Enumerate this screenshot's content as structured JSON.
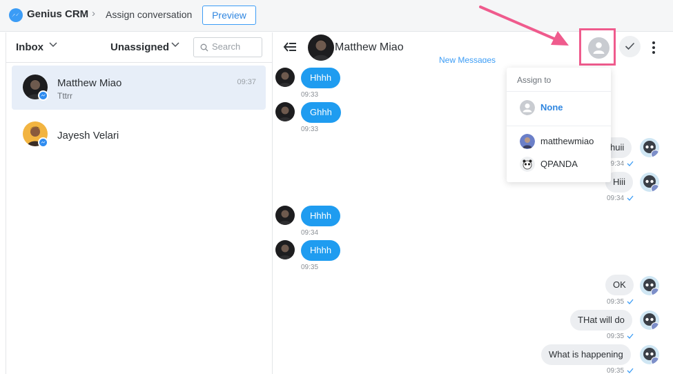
{
  "app": {
    "name": "Genius CRM",
    "breadcrumb_separator": "›",
    "page_title": "Assign conversation",
    "preview_label": "Preview",
    "brand_color": "#3b9cf6"
  },
  "left": {
    "inbox_label": "Inbox",
    "filter_label": "Unassigned",
    "search_placeholder": "Search",
    "conversations": [
      {
        "name": "Matthew Miao",
        "time": "09:37",
        "preview": "Tttrr",
        "active": true
      },
      {
        "name": "Jayesh Velari",
        "time": "",
        "preview": "",
        "active": false
      }
    ]
  },
  "chat": {
    "contact_name": "Matthew Miao",
    "new_messages_label": "New Messages",
    "messages": [
      {
        "direction": "in",
        "text": "Hhhh",
        "time": "09:33"
      },
      {
        "direction": "in",
        "text": "Ghhh",
        "time": "09:33"
      },
      {
        "direction": "out",
        "text": "huii",
        "time": "09:34"
      },
      {
        "direction": "out",
        "text": "Hiii",
        "time": "09:34"
      },
      {
        "direction": "in",
        "text": "Hhhh",
        "time": "09:34"
      },
      {
        "direction": "in",
        "text": "Hhhh",
        "time": "09:35"
      },
      {
        "direction": "out",
        "text": "OK",
        "time": "09:35"
      },
      {
        "direction": "out",
        "text": "THat will do",
        "time": "09:35"
      },
      {
        "direction": "out",
        "text": "What is happening",
        "time": "09:35"
      }
    ],
    "incoming_bubble_color": "#1f9cf0",
    "outgoing_bubble_color": "#eceef1",
    "highlight_color": "#ef5b8d"
  },
  "assign_menu": {
    "title": "Assign to",
    "options": [
      "None",
      "matthewmiao",
      "QPANDA"
    ]
  }
}
